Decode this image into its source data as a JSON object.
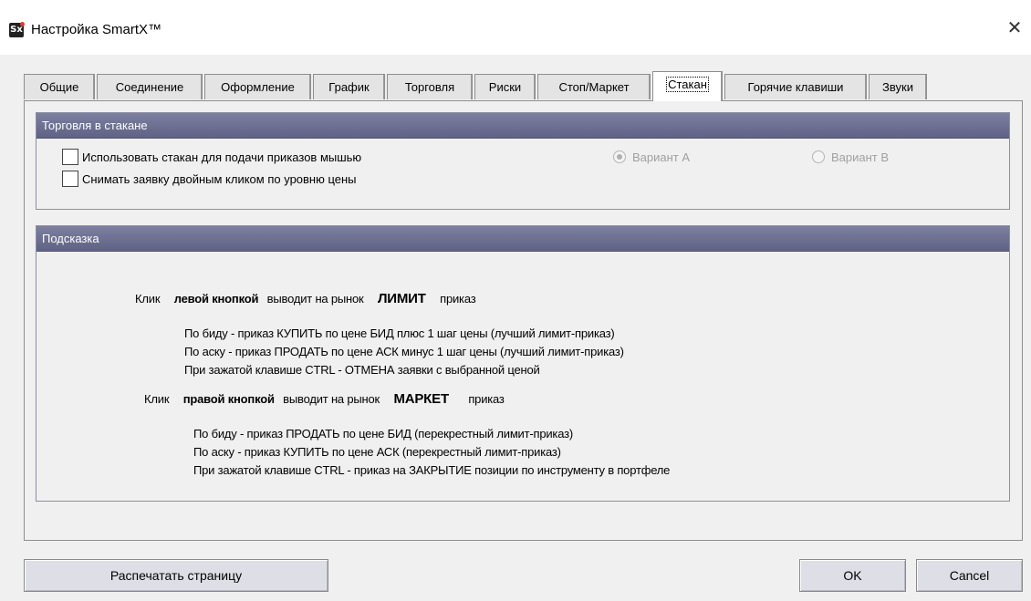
{
  "window": {
    "title": "Настройка SmartX™",
    "icon_label": "Sx",
    "close_glyph": "✕"
  },
  "tabs": [
    {
      "label": "Общие",
      "active": false
    },
    {
      "label": "Соединение",
      "active": false
    },
    {
      "label": "Оформление",
      "active": false
    },
    {
      "label": "График",
      "active": false
    },
    {
      "label": "Торговля",
      "active": false
    },
    {
      "label": "Риски",
      "active": false
    },
    {
      "label": "Стоп/Маркет",
      "active": false
    },
    {
      "label": "Стакан",
      "active": true
    },
    {
      "label": "Горячие клавиши",
      "active": false
    },
    {
      "label": "Звуки",
      "active": false
    }
  ],
  "trading_group": {
    "title": "Торговля в стакане",
    "use_book_checkbox": {
      "label": "Использовать стакан для подачи приказов мышью",
      "checked": false
    },
    "dblclick_checkbox": {
      "label": "Снимать заявку двойным кликом по уровню цены",
      "checked": false
    },
    "variant_a": {
      "label": "Вариант А",
      "selected": true,
      "enabled": false
    },
    "variant_b": {
      "label": "Вариант В",
      "selected": false,
      "enabled": false
    }
  },
  "hint_group": {
    "title": "Подсказка",
    "left": {
      "click": "Клик",
      "button": "левой кнопкой",
      "action": "выводит на рынок",
      "order_type": "ЛИМИТ",
      "suffix": "приказ",
      "lines": [
        "По биду - приказ КУПИТЬ по цене БИД плюс 1 шаг цены (лучший лимит-приказ)",
        "По аску - приказ ПРОДАТЬ по цене АСК минус 1 шаг цены (лучший лимит-приказ)",
        "При зажатой клавише CTRL - ОТМЕНА заявки с выбранной ценой"
      ]
    },
    "right": {
      "click": "Клик",
      "button": "правой кнопкой",
      "action": "выводит на рынок",
      "order_type": "МАРКЕТ",
      "suffix": "приказ",
      "lines": [
        "По биду - приказ ПРОДАТЬ по цене БИД (перекрестный лимит-приказ)",
        "По аску - приказ КУПИТЬ по цене АСК (перекрестный лимит-приказ)",
        "При зажатой клавише CTRL - приказ на ЗАКРЫТИЕ позиции по инструменту в портфеле"
      ]
    }
  },
  "buttons": {
    "print": "Распечатать страницу",
    "ok": "OK",
    "cancel": "Cancel"
  },
  "colors": {
    "group_header": "#6e7193",
    "window_bg": "#f0f0f0"
  }
}
